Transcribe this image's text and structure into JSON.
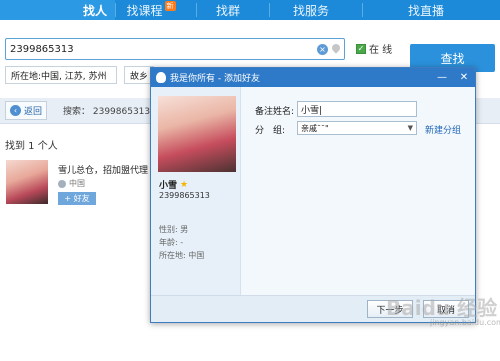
{
  "nav": {
    "tabs": [
      {
        "label": "找人",
        "active": true
      },
      {
        "label": "找课程",
        "badge": "新"
      },
      {
        "label": "找群"
      },
      {
        "label": "找服务"
      },
      {
        "label": "找直播"
      }
    ]
  },
  "search": {
    "query": "2399865313",
    "online_label": "在 线",
    "online_checked": true,
    "find_button": "查找",
    "location_select": "所在地:中国, 江苏, 苏州",
    "hometown_select": "故乡"
  },
  "backbar": {
    "back_label": "返回",
    "search_crumb": "搜索： 2399865313"
  },
  "results": {
    "count_text": "找到 1 个人",
    "items": [
      {
        "name": "雪儿总仓，招加盟代理",
        "location": "中国",
        "add_label": "+ 好友"
      }
    ]
  },
  "dialog": {
    "title": "我是你所有 - 添加好友",
    "profile": {
      "name": "小雪",
      "qq": "2399865313",
      "gender": "性别: 男",
      "age": "年龄: -",
      "location": "所在地: 中国"
    },
    "remark_label": "备注姓名:",
    "remark_value": "小雪|",
    "group_label": "分　组:",
    "group_value": "亲戚¯¯\"",
    "new_group_link": "新建分组",
    "next_button": "下一步",
    "cancel_button": "取消"
  },
  "watermark": {
    "text": "Baidu 经验",
    "sub": "jingyan.baidu.com"
  },
  "colors": {
    "nav_bg": "#1c8ad8",
    "accent": "#2b91dc",
    "dialog_title_bg": "#2f7ac8"
  }
}
